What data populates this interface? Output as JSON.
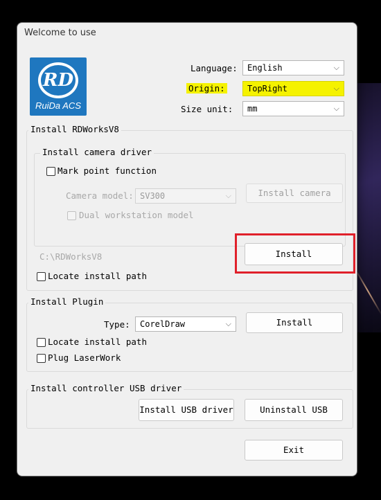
{
  "dialog": {
    "title": "Welcome to use"
  },
  "logo": {
    "mark": "RD",
    "caption": "RuiDa ACS"
  },
  "settings": {
    "language": {
      "label": "Language:",
      "value": "English"
    },
    "origin": {
      "label": "Origin:",
      "value": "TopRight"
    },
    "size_unit": {
      "label": "Size unit:",
      "value": "mm"
    }
  },
  "install_rdworks": {
    "group_title": "Install RDWorksV8",
    "camera": {
      "group_title": "Install camera driver",
      "mark_point_label": "Mark point function",
      "mark_point_checked": false,
      "camera_model_label": "Camera model:",
      "camera_model_value": "SV300",
      "install_camera_label": "Install camera",
      "dual_workstation_label": "Dual workstation model",
      "dual_workstation_checked": false
    },
    "install_path": "C:\\RDWorksV8",
    "install_label": "Install",
    "locate_path_label": "Locate install path",
    "locate_path_checked": false
  },
  "plugin": {
    "group_title": "Install Plugin",
    "type_label": "Type:",
    "type_value": "CorelDraw",
    "install_label": "Install",
    "locate_path_label": "Locate install path",
    "locate_path_checked": false,
    "plug_laserwork_label": "Plug LaserWork",
    "plug_laserwork_checked": false
  },
  "usb": {
    "group_title": "Install controller USB driver",
    "install_label": "Install USB driver",
    "uninstall_label": "Uninstall USB"
  },
  "exit_label": "Exit",
  "colors": {
    "highlight": "#f5f200",
    "annotation": "#e0202a",
    "logo_bg": "#1f77bf"
  }
}
